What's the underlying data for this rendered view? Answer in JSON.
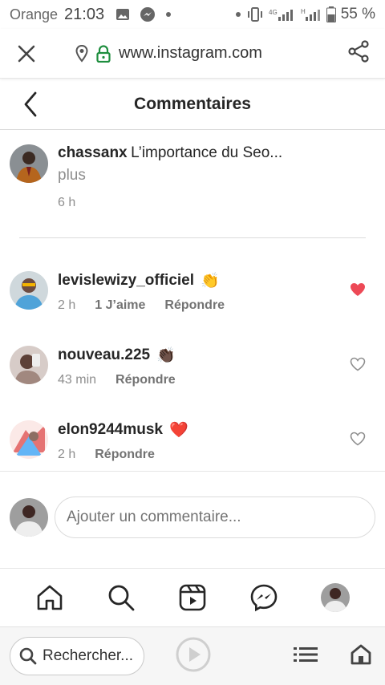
{
  "status": {
    "carrier": "Orange",
    "time": "21:03",
    "battery": "55 %"
  },
  "browser": {
    "url": "www.instagram.com",
    "search_placeholder": "Rechercher..."
  },
  "header": {
    "title": "Commentaires"
  },
  "caption": {
    "username": "chassanx",
    "text": "L’importance du Seo...",
    "more": "plus",
    "time": "6 h"
  },
  "comments": [
    {
      "username": "levislewizy_officiel",
      "emoji": "👏",
      "time": "2 h",
      "likes": "1 J’aime",
      "reply": "Répondre",
      "liked": true
    },
    {
      "username": "nouveau.225",
      "emoji": "👏🏿",
      "time": "43 min",
      "reply": "Répondre",
      "liked": false
    },
    {
      "username": "elon9244musk",
      "emoji": "❤️",
      "time": "2 h",
      "reply": "Répondre",
      "liked": false
    }
  ],
  "add_comment": {
    "placeholder": "Ajouter un commentaire..."
  },
  "colors": {
    "like_red": "#ed4956",
    "text": "#262626",
    "secondary": "#8e8e8e",
    "secure_green": "#1e8e3e"
  },
  "icons": [
    "close-icon",
    "location-icon",
    "lock-icon",
    "share-icon",
    "back-icon",
    "heart-icon",
    "home-icon",
    "search-icon",
    "reels-icon",
    "messenger-icon",
    "play-icon",
    "list-icon",
    "house-icon"
  ]
}
